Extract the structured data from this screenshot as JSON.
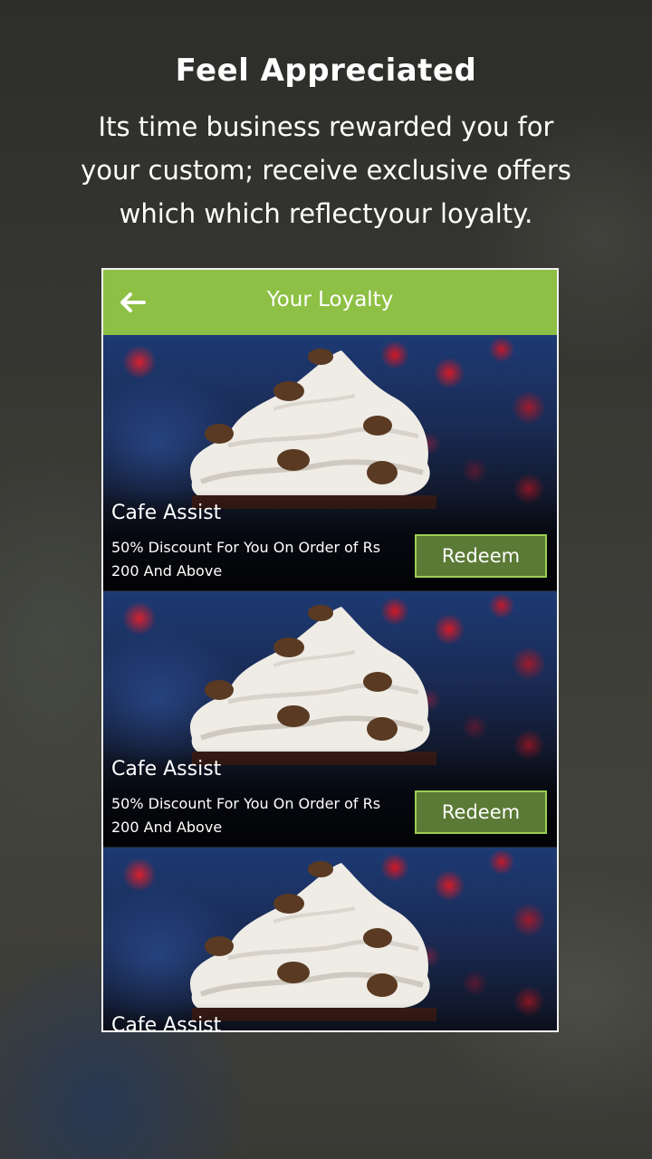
{
  "promo": {
    "headline": "Feel Appreciated",
    "subtitle": "Its time business rewarded you for your custom; receive exclusive offers which which reflectyour loyalty."
  },
  "app": {
    "title": "Your Loyalty",
    "back_icon": "arrow-left-icon",
    "accent_color": "#8dc044",
    "button_color": "#5b7a36"
  },
  "offers": [
    {
      "title": "Cafe Assist",
      "description": "50% Discount For You On Order of Rs 200 And Above",
      "button_label": "Redeem"
    },
    {
      "title": "Cafe Assist",
      "description": "50% Discount For You On Order of Rs 200 And Above",
      "button_label": "Redeem"
    },
    {
      "title": "Cafe Assist",
      "description": "",
      "button_label": ""
    }
  ]
}
